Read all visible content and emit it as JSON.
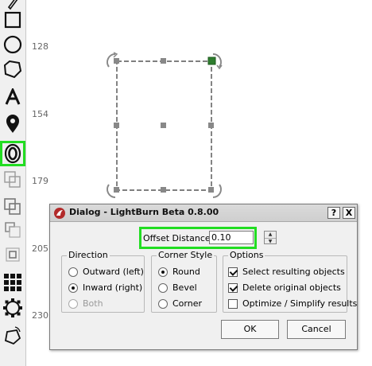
{
  "colors": {
    "highlight": "#22dd22",
    "handle_active": "#2e7d2e",
    "selection_box": "#333333"
  },
  "toolbar": {
    "tools": [
      {
        "name": "edit-nodes-icon"
      },
      {
        "name": "rectangle-icon"
      },
      {
        "name": "ellipse-icon"
      },
      {
        "name": "polygon-icon"
      },
      {
        "name": "text-icon"
      },
      {
        "name": "position-laser-icon"
      },
      {
        "name": "offset-shapes-icon",
        "selected": true
      },
      {
        "name": "weld-icon"
      },
      {
        "name": "boolean-union-icon"
      },
      {
        "name": "boolean-subtract-icon"
      },
      {
        "name": "boolean-intersect-icon"
      },
      {
        "name": "array-icon"
      },
      {
        "name": "circular-array-icon"
      },
      {
        "name": "rotate-shape-icon"
      }
    ]
  },
  "ruler": {
    "labels": [
      "128",
      "154",
      "179",
      "205",
      "230"
    ]
  },
  "dialog": {
    "title": "Dialog - LightBurn Beta 0.8.00",
    "help_button": "?",
    "close_button": "X",
    "offset_label": "Offset Distance",
    "offset_value": "0.10",
    "direction": {
      "title": "Direction",
      "options": [
        "Outward (left)",
        "Inward (right)",
        "Both"
      ],
      "selected": "Inward (right)"
    },
    "corner_style": {
      "title": "Corner Style",
      "options": [
        "Round",
        "Bevel",
        "Corner"
      ],
      "selected": "Round"
    },
    "options": {
      "title": "Options",
      "items": [
        {
          "label": "Select resulting objects",
          "checked": true
        },
        {
          "label": "Delete original objects",
          "checked": true
        },
        {
          "label": "Optimize / Simplify results",
          "checked": false
        }
      ]
    },
    "ok_label": "OK",
    "cancel_label": "Cancel"
  }
}
